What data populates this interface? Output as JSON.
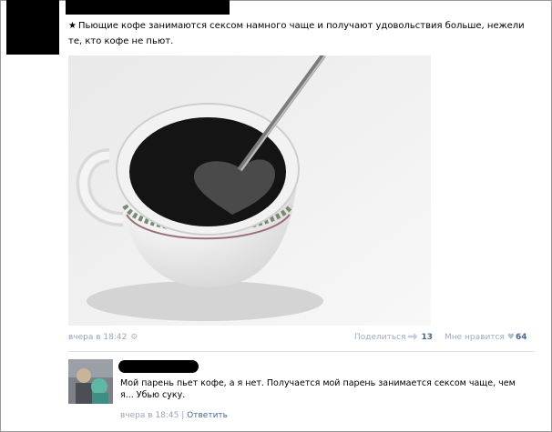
{
  "post": {
    "author_name": "",
    "star": "★",
    "text": "Пьющие кофе занимаются сексом намного чаще и получают удовольствия больше, нежели те, кто кофе не пьют.",
    "date": "вчера в 18:42",
    "camera_icon": "camera-icon",
    "share_label": "Поделиться",
    "share_count": "13",
    "like_label": "Мне нравится",
    "like_count": "64"
  },
  "comment": {
    "author_name": "",
    "text": "Мой парень пьет кофе, а я нет. Получается мой парень занимается сексом чаще, чем я... Убью суку.",
    "date": "вчера в 18:45",
    "separator": "|",
    "reply_label": "Ответить"
  },
  "colors": {
    "link": "#45688e",
    "meta": "#9aa6b8",
    "divider": "#dde3ea"
  }
}
